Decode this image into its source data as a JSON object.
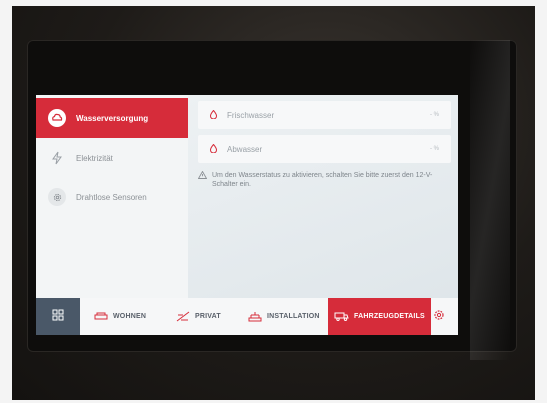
{
  "sidebar": {
    "items": [
      {
        "label": "Wasserversorgung",
        "icon": "water-supply-icon",
        "active": true
      },
      {
        "label": "Elektrizität",
        "icon": "lightning-icon",
        "active": false
      },
      {
        "label": "Drahtlose Sensoren",
        "icon": "gear-icon",
        "active": false
      }
    ]
  },
  "tanks": [
    {
      "label": "Frischwasser",
      "unit": "- %",
      "icon": "water-drop-icon"
    },
    {
      "label": "Abwasser",
      "unit": "- %",
      "icon": "water-drop-icon"
    }
  ],
  "notice": {
    "icon": "warning-icon",
    "text": "Um den Wasserstatus zu aktivieren, schalten Sie bitte zuerst den 12-V-Schalter ein."
  },
  "bottom_nav": {
    "apps_icon": "grid-icon",
    "items": [
      {
        "label": "WOHNEN",
        "icon": "sofa-icon",
        "active": false
      },
      {
        "label": "PRIVAT",
        "icon": "privacy-icon",
        "active": false
      },
      {
        "label": "INSTALLATION",
        "icon": "installation-icon",
        "active": false
      },
      {
        "label": "FAHRZEUGDETAILS",
        "icon": "vehicle-icon",
        "active": true
      }
    ],
    "settings_icon": "gear-icon"
  },
  "colors": {
    "accent": "#d62c3a",
    "apps_bg": "#4a5868",
    "text_muted": "#8c9196"
  }
}
